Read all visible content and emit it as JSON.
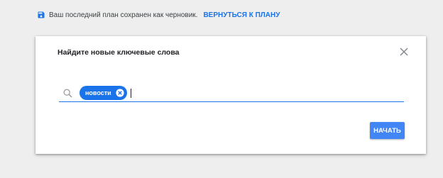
{
  "draft_notice": {
    "icon": "save-icon",
    "text": "Ваш последний план сохранен как черновик.",
    "link_label": "ВЕРНУТЬСЯ К ПЛАНУ"
  },
  "dialog": {
    "title": "Найдите новые ключевые слова",
    "close_icon": "close-icon",
    "search": {
      "icon": "search-icon",
      "chips": [
        {
          "label": "новости",
          "remove_icon": "remove-chip-icon"
        }
      ],
      "input_value": ""
    },
    "start_button_label": "НАЧАТЬ"
  },
  "colors": {
    "accent": "#1a73e8",
    "button": "#4285f4",
    "background": "#eeeeee"
  }
}
